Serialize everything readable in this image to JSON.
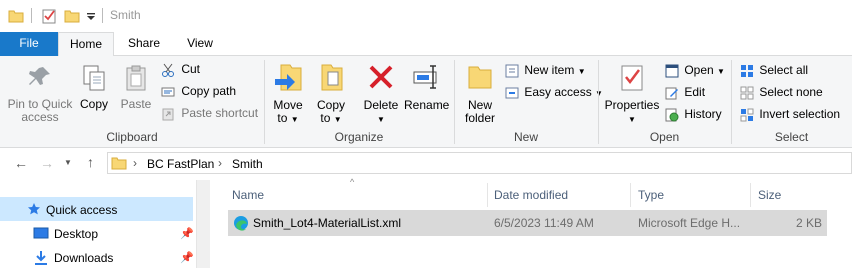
{
  "window": {
    "title": "Smith"
  },
  "ribbon_tabs": {
    "file": "File",
    "home": "Home",
    "share": "Share",
    "view": "View"
  },
  "clipboard": {
    "pin_label_1": "Pin to Quick",
    "pin_label_2": "access",
    "copy": "Copy",
    "paste": "Paste",
    "cut": "Cut",
    "copy_path": "Copy path",
    "paste_shortcut": "Paste shortcut",
    "group": "Clipboard"
  },
  "organize": {
    "move_1": "Move",
    "move_2": "to",
    "copy_1": "Copy",
    "copy_2": "to",
    "delete": "Delete",
    "rename": "Rename",
    "group": "Organize"
  },
  "new": {
    "new_folder_1": "New",
    "new_folder_2": "folder",
    "new_item": "New item",
    "easy_access": "Easy access",
    "group": "New"
  },
  "open": {
    "properties": "Properties",
    "open": "Open",
    "edit": "Edit",
    "history": "History",
    "group": "Open"
  },
  "select": {
    "select_all": "Select all",
    "select_none": "Select none",
    "invert": "Invert selection",
    "group": "Select"
  },
  "address": {
    "crumb1": "BC FastPlan",
    "crumb2": "Smith"
  },
  "nav": {
    "quick_access": "Quick access",
    "desktop": "Desktop",
    "downloads": "Downloads"
  },
  "columns": {
    "name": "Name",
    "date": "Date modified",
    "type": "Type",
    "size": "Size"
  },
  "files": [
    {
      "name": "Smith_Lot4-MaterialList.xml",
      "date": "6/5/2023 11:49 AM",
      "type": "Microsoft Edge H...",
      "size": "2 KB"
    }
  ],
  "colors": {
    "accent": "#1979ca",
    "folder": "#f8d775",
    "selection": "#cce8ff"
  }
}
